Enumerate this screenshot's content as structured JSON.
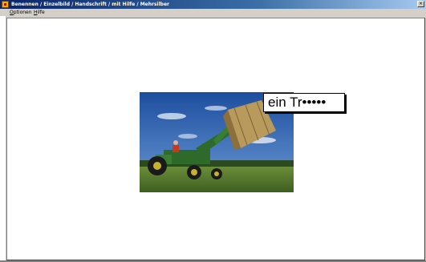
{
  "window": {
    "title": "Benennen / Einzelbild / Handschrift / mit Hilfe / Mehrsilber",
    "app_icon": "app-icon",
    "controls": {
      "close": "×"
    }
  },
  "menubar": {
    "items": [
      {
        "label": "Optionen"
      },
      {
        "label": "Hilfe"
      }
    ]
  },
  "content": {
    "image": {
      "subject": "tractor-with-hay-bale",
      "colors": {
        "sky": "#2a5fb5",
        "grass": "#4f7a2a",
        "tractor": "#2e6b2a",
        "hay": "#b89a5c"
      }
    },
    "label": {
      "text": "ein Tr•••••"
    }
  }
}
